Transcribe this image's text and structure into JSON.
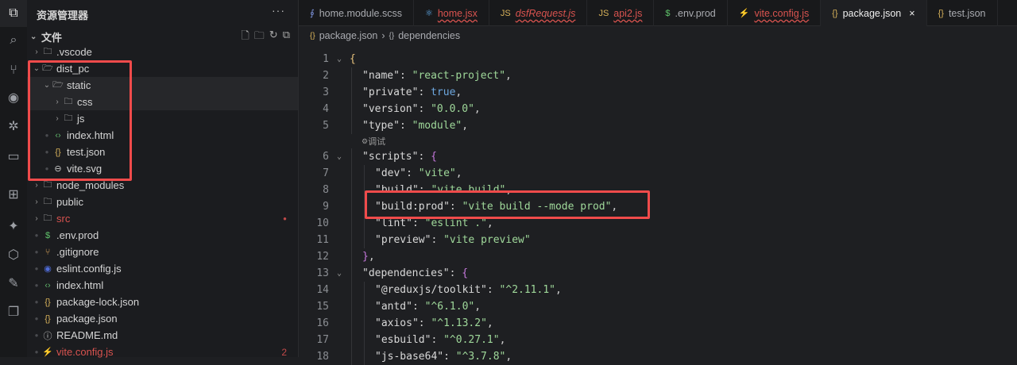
{
  "activity_bar": [
    {
      "name": "explorer-icon",
      "glyph": "⧉",
      "active": true
    },
    {
      "name": "search-icon",
      "glyph": "⌕"
    },
    {
      "name": "source-control-icon",
      "glyph": "⑂"
    },
    {
      "name": "eye-icon",
      "glyph": "◉"
    },
    {
      "name": "debug-icon",
      "glyph": "✲"
    },
    {
      "name": "remote-icon",
      "glyph": "▭"
    },
    {
      "name": "extensions-icon",
      "glyph": "⊞"
    },
    {
      "name": "plugin-icon",
      "glyph": "✦"
    },
    {
      "name": "cube-icon",
      "glyph": "⬡"
    },
    {
      "name": "brush-icon",
      "glyph": "✎"
    },
    {
      "name": "copy-icon",
      "glyph": "❐"
    }
  ],
  "sidebar": {
    "title": "资源管理器",
    "more": "···",
    "section": "文件",
    "items": [
      {
        "label": ".vscode",
        "type": "folder",
        "depth": 0,
        "open": false
      },
      {
        "label": "dist_pc",
        "type": "folder",
        "depth": 0,
        "open": true
      },
      {
        "label": "static",
        "type": "folder",
        "depth": 1,
        "open": true,
        "hl": true
      },
      {
        "label": "css",
        "type": "folder",
        "depth": 2,
        "open": false,
        "hl": true
      },
      {
        "label": "js",
        "type": "folder",
        "depth": 2,
        "open": false
      },
      {
        "label": "index.html",
        "type": "html",
        "depth": 1
      },
      {
        "label": "test.json",
        "type": "json",
        "depth": 1
      },
      {
        "label": "vite.svg",
        "type": "svg",
        "depth": 1
      },
      {
        "label": "node_modules",
        "type": "folder",
        "depth": 0,
        "open": false
      },
      {
        "label": "public",
        "type": "folder",
        "depth": 0,
        "open": false
      },
      {
        "label": "src",
        "type": "folder",
        "depth": 0,
        "open": false,
        "error": true,
        "badge": "●"
      },
      {
        "label": ".env.prod",
        "type": "env",
        "depth": 0
      },
      {
        "label": ".gitignore",
        "type": "git",
        "depth": 0
      },
      {
        "label": "eslint.config.js",
        "type": "eslint",
        "depth": 0
      },
      {
        "label": "index.html",
        "type": "html",
        "depth": 0
      },
      {
        "label": "package-lock.json",
        "type": "json",
        "depth": 0
      },
      {
        "label": "package.json",
        "type": "json",
        "depth": 0
      },
      {
        "label": "README.md",
        "type": "info",
        "depth": 0
      },
      {
        "label": "vite.config.js",
        "type": "vite",
        "depth": 0,
        "error": true,
        "badge": "2"
      }
    ]
  },
  "tabs": [
    {
      "label": "home.module.scss",
      "icon": "∮",
      "icolor": "#7a8fd6"
    },
    {
      "label": "home.jsx",
      "icon": "⚛",
      "icolor": "#61afef",
      "error": true
    },
    {
      "label": "dsfRequest.js",
      "icon": "JS",
      "icolor": "#d8b25a",
      "error": true,
      "italic": true
    },
    {
      "label": "api2.js",
      "icon": "JS",
      "icolor": "#d8b25a",
      "error": true
    },
    {
      "label": ".env.prod",
      "icon": "$",
      "icolor": "#5fc36a"
    },
    {
      "label": "vite.config.js",
      "icon": "⚡",
      "icolor": "#e5c07b",
      "error": true
    },
    {
      "label": "package.json",
      "icon": "{}",
      "icolor": "#d8b25a",
      "active": true,
      "close": "×"
    },
    {
      "label": "test.json",
      "icon": "{}",
      "icolor": "#d8b25a"
    }
  ],
  "breadcrumb": {
    "file": "package.json",
    "separator": "›",
    "symbol": "dependencies"
  },
  "codelens": "调试",
  "code": [
    {
      "n": "1",
      "fold": true,
      "indent": 0,
      "t": [
        [
          "br1",
          "{"
        ]
      ]
    },
    {
      "n": "2",
      "indent": 1,
      "t": [
        [
          "k",
          "\"name\""
        ],
        [
          "p",
          ": "
        ],
        [
          "s",
          "\"react-project\""
        ],
        [
          "p",
          ","
        ]
      ]
    },
    {
      "n": "3",
      "indent": 1,
      "t": [
        [
          "k",
          "\"private\""
        ],
        [
          "p",
          ": "
        ],
        [
          "b",
          "true"
        ],
        [
          "p",
          ","
        ]
      ]
    },
    {
      "n": "4",
      "indent": 1,
      "t": [
        [
          "k",
          "\"version\""
        ],
        [
          "p",
          ": "
        ],
        [
          "s",
          "\"0.0.0\""
        ],
        [
          "p",
          ","
        ]
      ]
    },
    {
      "n": "5",
      "indent": 1,
      "t": [
        [
          "k",
          "\"type\""
        ],
        [
          "p",
          ": "
        ],
        [
          "s",
          "\"module\""
        ],
        [
          "p",
          ","
        ]
      ],
      "lens_after": true
    },
    {
      "n": "6",
      "fold": true,
      "indent": 1,
      "t": [
        [
          "k",
          "\"scripts\""
        ],
        [
          "p",
          ": "
        ],
        [
          "br2",
          "{"
        ]
      ]
    },
    {
      "n": "7",
      "indent": 2,
      "t": [
        [
          "k",
          "\"dev\""
        ],
        [
          "p",
          ": "
        ],
        [
          "s",
          "\"vite\""
        ],
        [
          "p",
          ","
        ]
      ]
    },
    {
      "n": "8",
      "indent": 2,
      "t": [
        [
          "k",
          "\"build\""
        ],
        [
          "p",
          ": "
        ],
        [
          "s",
          "\"vite build\""
        ],
        [
          "p",
          ","
        ]
      ]
    },
    {
      "n": "9",
      "indent": 2,
      "t": [
        [
          "k",
          "\"build:prod\""
        ],
        [
          "p",
          ": "
        ],
        [
          "s",
          "\"vite build --mode prod\""
        ],
        [
          "p",
          ","
        ]
      ]
    },
    {
      "n": "10",
      "indent": 2,
      "t": [
        [
          "k",
          "\"lint\""
        ],
        [
          "p",
          ": "
        ],
        [
          "s",
          "\"eslint .\""
        ],
        [
          "p",
          ","
        ]
      ]
    },
    {
      "n": "11",
      "indent": 2,
      "t": [
        [
          "k",
          "\"preview\""
        ],
        [
          "p",
          ": "
        ],
        [
          "s",
          "\"vite preview\""
        ]
      ]
    },
    {
      "n": "12",
      "indent": 1,
      "t": [
        [
          "br2",
          "}"
        ],
        [
          "p",
          ","
        ]
      ]
    },
    {
      "n": "13",
      "fold": true,
      "indent": 1,
      "t": [
        [
          "k",
          "\"dependencies\""
        ],
        [
          "p",
          ": "
        ],
        [
          "br2",
          "{"
        ]
      ]
    },
    {
      "n": "14",
      "indent": 2,
      "t": [
        [
          "k",
          "\"@reduxjs/toolkit\""
        ],
        [
          "p",
          ": "
        ],
        [
          "s",
          "\"^2.11.1\""
        ],
        [
          "p",
          ","
        ]
      ]
    },
    {
      "n": "15",
      "indent": 2,
      "t": [
        [
          "k",
          "\"antd\""
        ],
        [
          "p",
          ": "
        ],
        [
          "s",
          "\"^6.1.0\""
        ],
        [
          "p",
          ","
        ]
      ]
    },
    {
      "n": "16",
      "indent": 2,
      "t": [
        [
          "k",
          "\"axios\""
        ],
        [
          "p",
          ": "
        ],
        [
          "s",
          "\"^1.13.2\""
        ],
        [
          "p",
          ","
        ]
      ]
    },
    {
      "n": "17",
      "indent": 2,
      "t": [
        [
          "k",
          "\"esbuild\""
        ],
        [
          "p",
          ": "
        ],
        [
          "s",
          "\"^0.27.1\""
        ],
        [
          "p",
          ","
        ]
      ]
    },
    {
      "n": "18",
      "indent": 2,
      "t": [
        [
          "k",
          "\"js-base64\""
        ],
        [
          "p",
          ": "
        ],
        [
          "s",
          "\"^3.7.8\""
        ],
        [
          "p",
          ","
        ]
      ]
    }
  ]
}
